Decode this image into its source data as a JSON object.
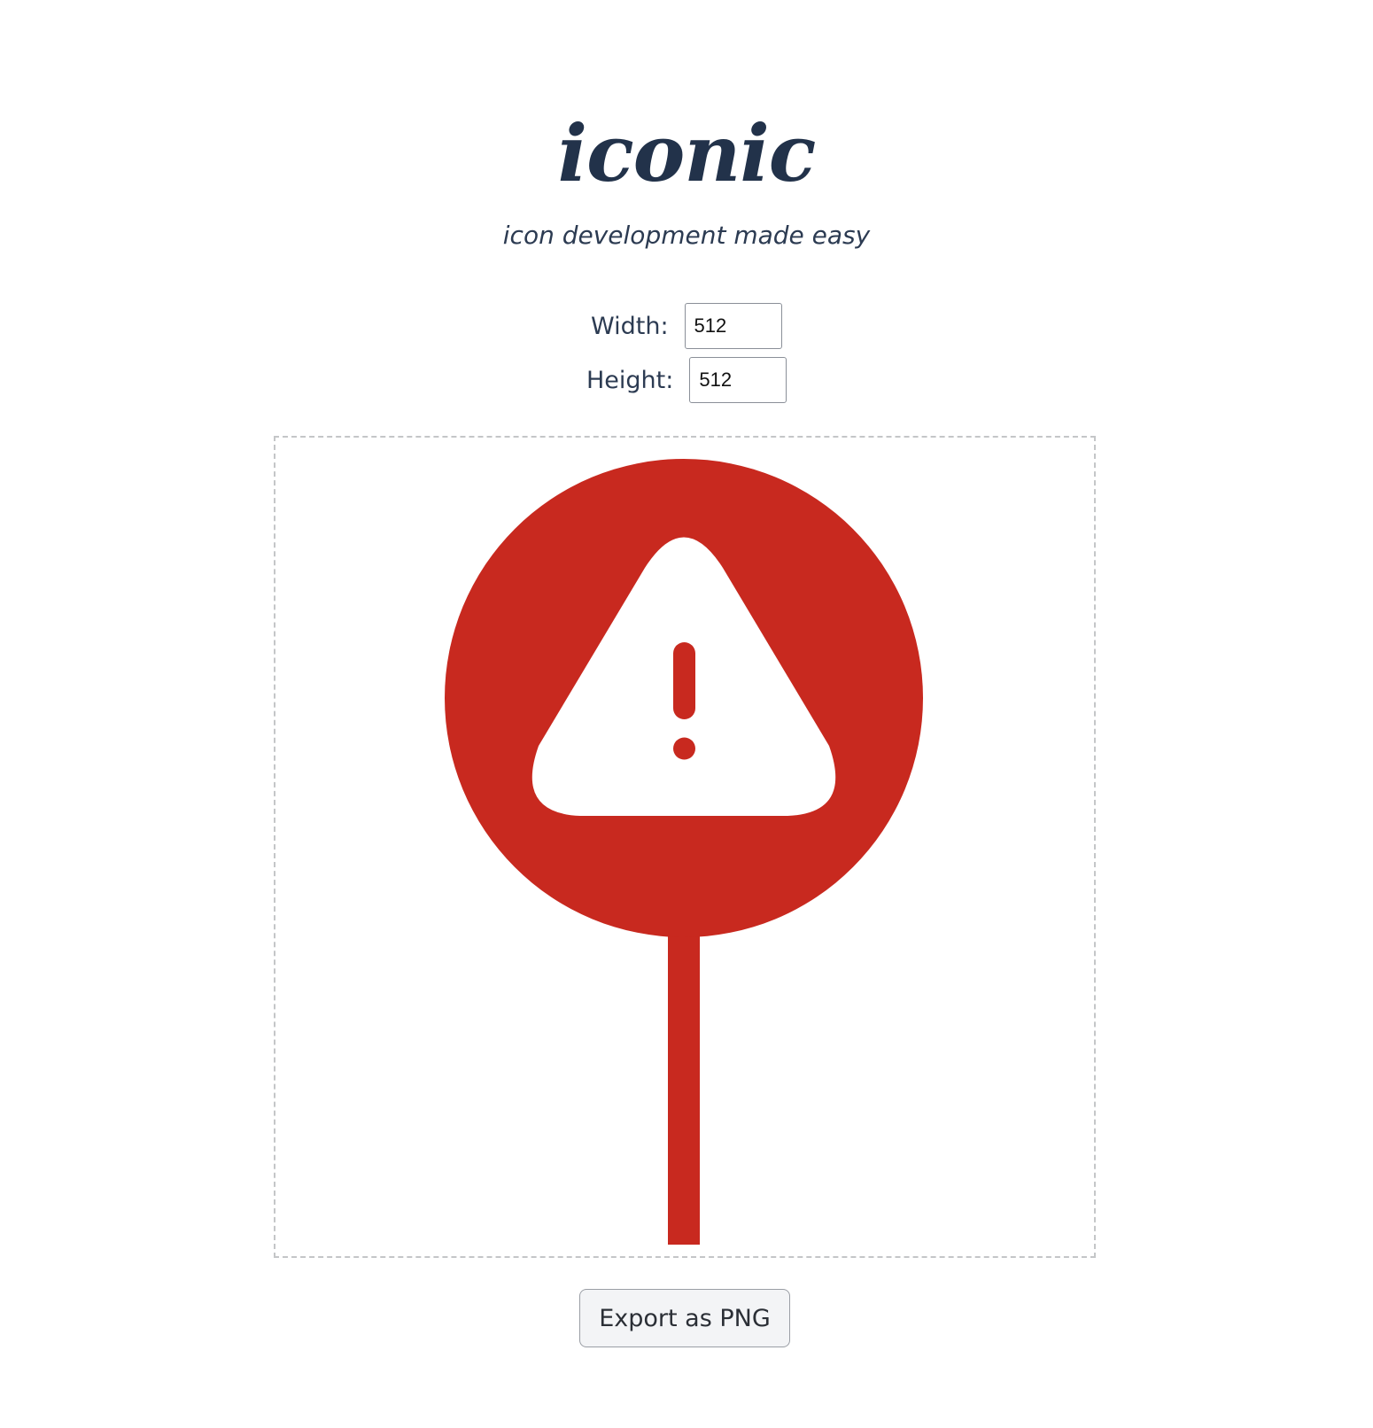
{
  "header": {
    "title": "iconic",
    "subtitle": "icon development made easy"
  },
  "controls": {
    "width_label": "Width:",
    "width_value": "512",
    "height_label": "Height:",
    "height_value": "512"
  },
  "icon": {
    "name": "warning-sign-icon",
    "color": "#c8291f",
    "glyph_color": "#ffffff"
  },
  "actions": {
    "export_label": "Export as PNG"
  }
}
